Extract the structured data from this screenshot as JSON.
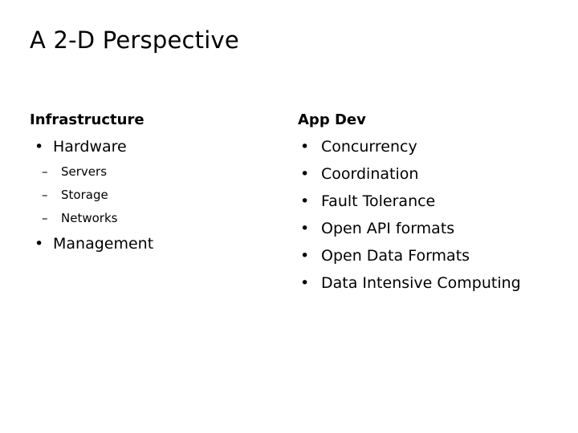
{
  "slide": {
    "title": "A 2-D Perspective",
    "background_color": "#ffffff",
    "text_color": "#000000",
    "columns": [
      {
        "heading": "Infrastructure",
        "bullet_glyph": "•",
        "subbullet_glyph": "–",
        "items": [
          {
            "label": "Hardware",
            "subitems": [
              {
                "label": "Servers"
              },
              {
                "label": "Storage"
              },
              {
                "label": "Networks"
              }
            ]
          },
          {
            "label": "Management",
            "subitems": []
          }
        ]
      },
      {
        "heading": "App Dev",
        "bullet_glyph": "•",
        "subbullet_glyph": "–",
        "items": [
          {
            "label": "Concurrency",
            "subitems": []
          },
          {
            "label": "Coordination",
            "subitems": []
          },
          {
            "label": "Fault Tolerance",
            "subitems": []
          },
          {
            "label": "Open API formats",
            "subitems": []
          },
          {
            "label": "Open Data Formats",
            "subitems": []
          },
          {
            "label": "Data Intensive Computing",
            "subitems": []
          }
        ]
      }
    ]
  }
}
